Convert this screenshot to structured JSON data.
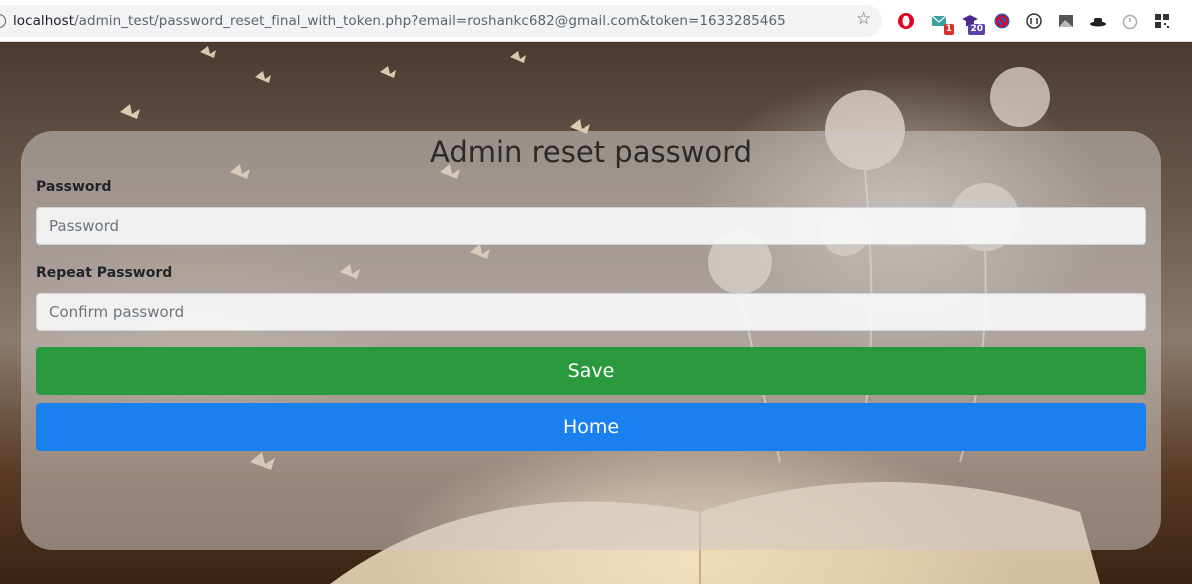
{
  "browser": {
    "url_host": "localhost",
    "url_path": "/admin_test/password_reset_final_with_token.php?email=roshankc682@gmail.com&token=1633285465",
    "star_icon": "bookmark-star-icon",
    "extensions": [
      {
        "name": "opera-extension-icon",
        "badge": ""
      },
      {
        "name": "mail-checker-icon",
        "badge": "1",
        "badge_color": "#d93025"
      },
      {
        "name": "graduation-cap-icon",
        "badge": "20",
        "badge_color": "#5b3fa6"
      },
      {
        "name": "blocker-icon",
        "badge": ""
      },
      {
        "name": "translate-icon",
        "badge": ""
      },
      {
        "name": "image-icon",
        "badge": ""
      },
      {
        "name": "hat-icon",
        "badge": ""
      },
      {
        "name": "timer-icon",
        "badge": ""
      },
      {
        "name": "qr-code-icon",
        "badge": ""
      }
    ]
  },
  "form": {
    "title": "Admin reset password",
    "password_label": "Password",
    "password_placeholder": "Password",
    "password_value": "",
    "repeat_label": "Repeat Password",
    "repeat_placeholder": "Confirm password",
    "repeat_value": "",
    "save_label": "Save",
    "home_label": "Home"
  },
  "colors": {
    "save_button": "#2b9a3f",
    "home_button": "#1a7fef"
  }
}
